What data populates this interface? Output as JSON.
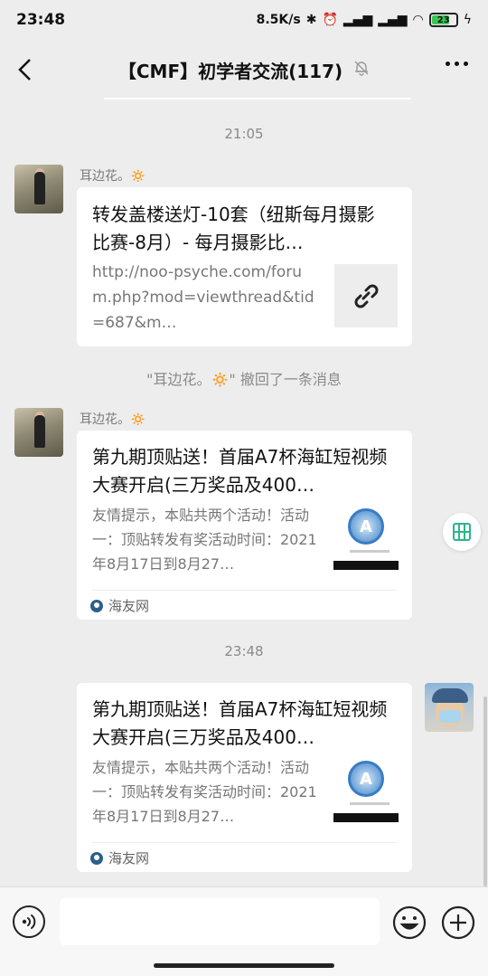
{
  "status_bar": {
    "time": "23:48",
    "net_speed": "8.5K/s",
    "battery": "23"
  },
  "header": {
    "title": "【CMF】初学者交流(117)"
  },
  "messages": {
    "time1": "21:05",
    "msg1": {
      "sender": "耳边花。🔅",
      "title": "转发盖楼送灯-10套（纽斯每月摄影比赛-8月）- 每月摄影比…",
      "url": "http://noo-psyche.com/forum.php?mod=viewthread&tid=687&m…"
    },
    "recall": "\"耳边花。🔅\" 撤回了一条消息",
    "msg2": {
      "sender": "耳边花。🔅",
      "title": "第九期顶贴送！首届A7杯海缸短视频大赛开启(三万奖品及400…",
      "desc": "友情提示，本贴共两个活动！活动一：顶贴转发有奖活动时间：2021年8月17日到8月27…",
      "source": "海友网"
    },
    "time2": "23:48",
    "msg3": {
      "title": "第九期顶贴送！首届A7杯海缸短视频大赛开启(三万奖品及400…",
      "desc": "友情提示，本贴共两个活动！活动一：顶贴转发有奖活动时间：2021年8月17日到8月27…",
      "source": "海友网"
    }
  },
  "thumb_text": "A",
  "input": {
    "placeholder": ""
  }
}
